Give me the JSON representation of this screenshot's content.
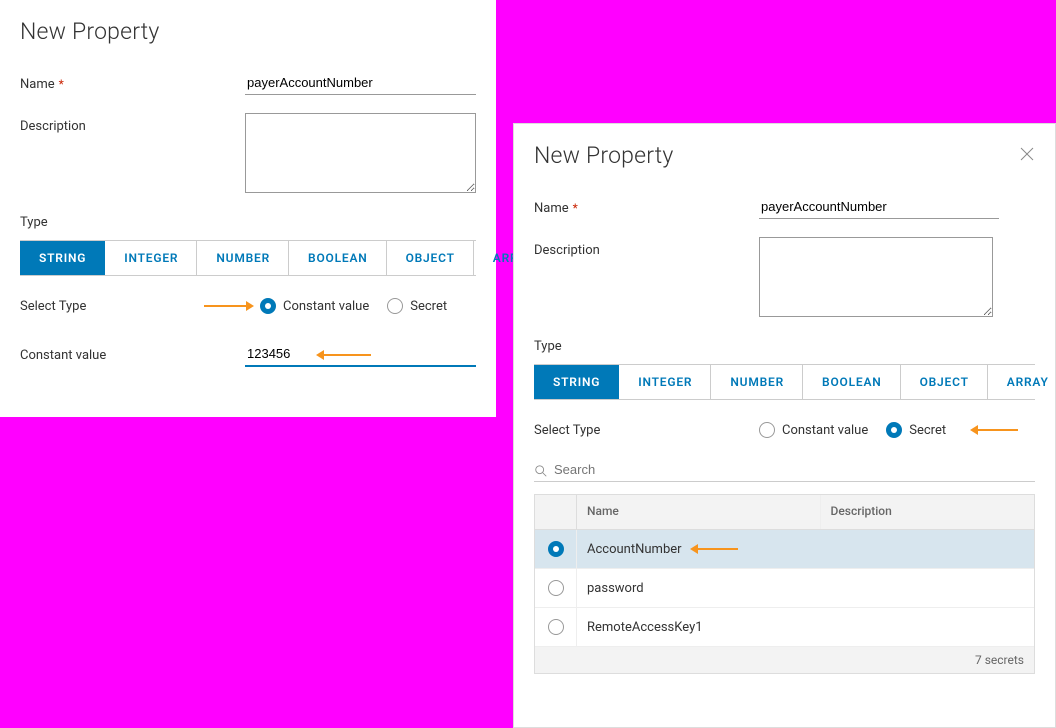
{
  "left": {
    "title": "New Property",
    "name_label": "Name",
    "name_value": "payerAccountNumber",
    "desc_label": "Description",
    "desc_value": "",
    "type_label": "Type",
    "tabs": [
      "STRING",
      "INTEGER",
      "NUMBER",
      "BOOLEAN",
      "OBJECT",
      "ARRAY"
    ],
    "select_type_label": "Select Type",
    "radio_constant": "Constant value",
    "radio_secret": "Secret",
    "constant_label": "Constant value",
    "constant_value": "123456"
  },
  "right": {
    "title": "New Property",
    "name_label": "Name",
    "name_value": "payerAccountNumber",
    "desc_label": "Description",
    "desc_value": "",
    "type_label": "Type",
    "tabs": [
      "STRING",
      "INTEGER",
      "NUMBER",
      "BOOLEAN",
      "OBJECT",
      "ARRAY"
    ],
    "select_type_label": "Select Type",
    "radio_constant": "Constant value",
    "radio_secret": "Secret",
    "search_placeholder": "Search",
    "table": {
      "head_name": "Name",
      "head_desc": "Description",
      "rows": [
        {
          "name": "AccountNumber",
          "desc": "",
          "selected": true
        },
        {
          "name": "password",
          "desc": "",
          "selected": false
        },
        {
          "name": "RemoteAccessKey1",
          "desc": "",
          "selected": false
        }
      ],
      "footer": "7 secrets"
    }
  }
}
